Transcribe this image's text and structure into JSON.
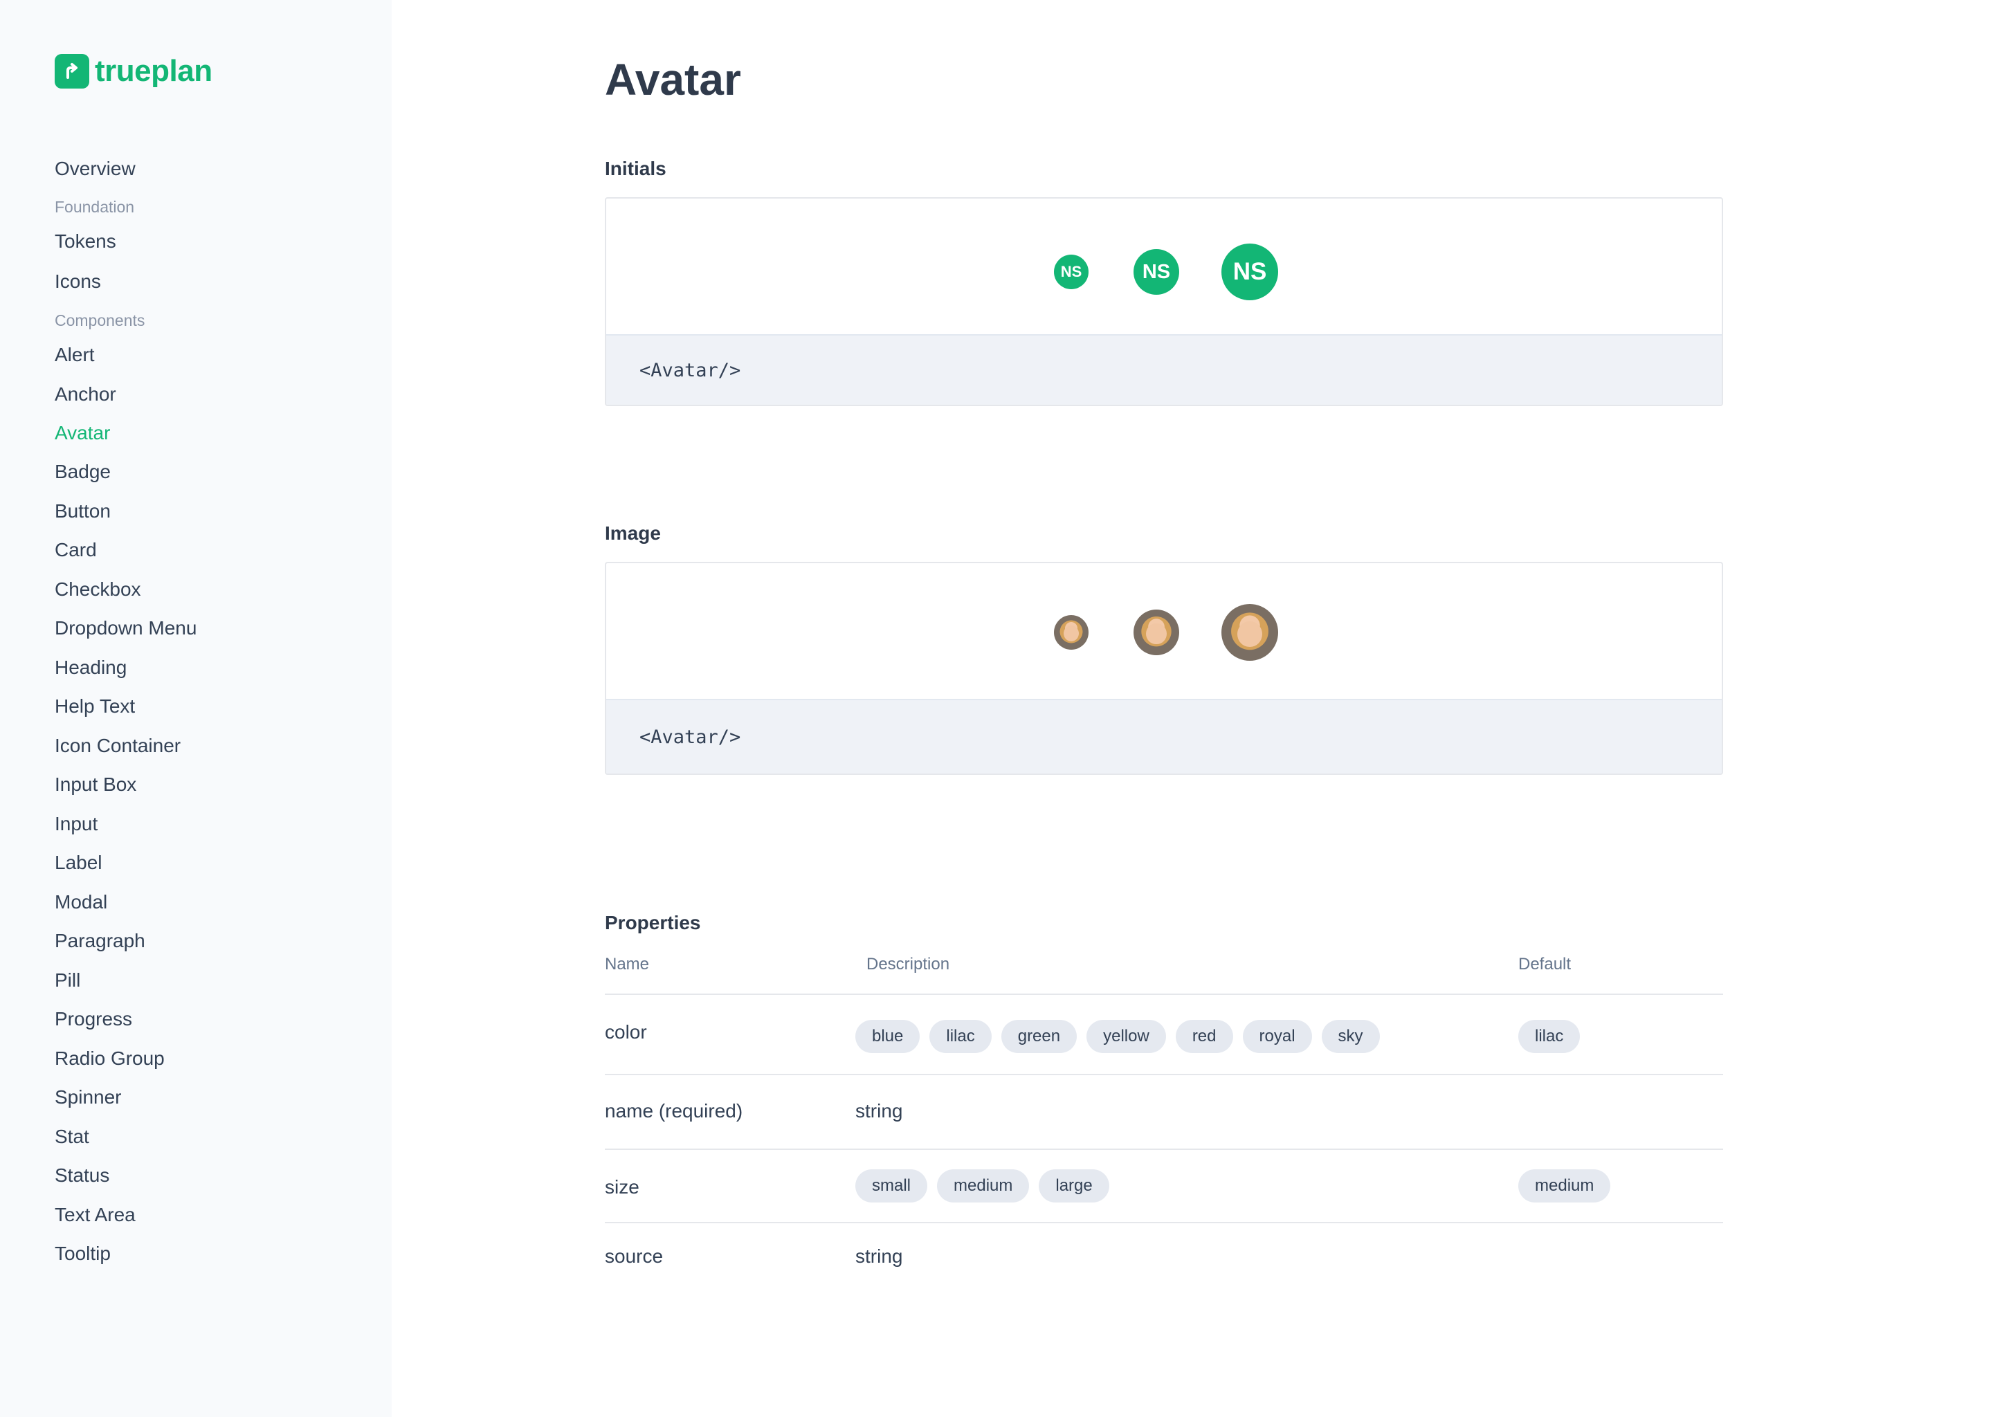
{
  "brand": {
    "name": "trueplan",
    "color": "#13b675",
    "icon": "arrow-up-right-icon"
  },
  "sidebar": {
    "overview": "Overview",
    "foundation_label": "Foundation",
    "foundation": [
      "Tokens",
      "Icons"
    ],
    "components_label": "Components",
    "components": [
      "Alert",
      "Anchor",
      "Avatar",
      "Badge",
      "Button",
      "Card",
      "Checkbox",
      "Dropdown Menu",
      "Heading",
      "Help Text",
      "Icon Container",
      "Input Box",
      "Input",
      "Label",
      "Modal",
      "Paragraph",
      "Pill",
      "Progress",
      "Radio Group",
      "Spinner",
      "Stat",
      "Status",
      "Text Area",
      "Tooltip"
    ],
    "active": "Avatar"
  },
  "page": {
    "title": "Avatar",
    "initials_section": {
      "title": "Initials",
      "avatars": [
        "NS",
        "NS",
        "NS"
      ],
      "code": "<Avatar/>"
    },
    "image_section": {
      "title": "Image",
      "code": "<Avatar/>"
    },
    "properties": {
      "title": "Properties",
      "headers": {
        "name": "Name",
        "description": "Description",
        "default": "Default"
      },
      "rows": [
        {
          "name": "color",
          "options": [
            "blue",
            "lilac",
            "green",
            "yellow",
            "red",
            "royal",
            "sky"
          ],
          "default": "lilac"
        },
        {
          "name": "name (required)",
          "description": "string"
        },
        {
          "name": "size",
          "options": [
            "small",
            "medium",
            "large"
          ],
          "default": "medium"
        },
        {
          "name": "source",
          "description": "string"
        }
      ]
    }
  }
}
